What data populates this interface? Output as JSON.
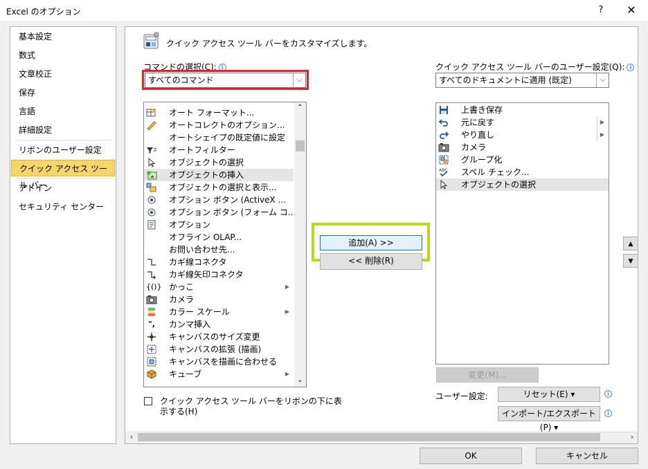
{
  "window": {
    "title": "Excel のオプション",
    "help_label": "?",
    "close_label": "✕"
  },
  "sidebar": {
    "items": [
      {
        "label": "基本設定"
      },
      {
        "label": "数式"
      },
      {
        "label": "文章校正"
      },
      {
        "label": "保存"
      },
      {
        "label": "言語"
      },
      {
        "label": "詳細設定"
      },
      {
        "label": "リボンのユーザー設定"
      },
      {
        "label": "クイック アクセス ツール バー",
        "selected": true
      },
      {
        "label": "アドイン"
      },
      {
        "label": "セキュリティ センター"
      }
    ]
  },
  "header": {
    "text": "クイック アクセス ツール バーをカスタマイズします。",
    "icon": "qat-customize-icon"
  },
  "commands": {
    "label": "コマンドの選択(C):",
    "selected": "すべてのコマンド",
    "items": [
      {
        "label": "オート フォーマット...",
        "icon": "autoformat-icon"
      },
      {
        "label": "オートコレクトのオプション...",
        "icon": "autocorrect-icon"
      },
      {
        "label": "オートシェイプの既定値に設定",
        "icon": ""
      },
      {
        "label": "オートフィルター",
        "icon": "filter-icon"
      },
      {
        "label": "オブジェクトの選択",
        "icon": "pointer-icon"
      },
      {
        "label": "オブジェクトの挿入",
        "icon": "insert-object-icon",
        "selected": true
      },
      {
        "label": "オブジェクトの選択と表示...",
        "icon": "selection-pane-icon"
      },
      {
        "label": "オプション ボタン (ActiveX ...",
        "icon": "radio-icon"
      },
      {
        "label": "オプション ボタン (フォーム コ...",
        "icon": "radio-icon"
      },
      {
        "label": "オプション",
        "icon": "options-icon"
      },
      {
        "label": "オフライン OLAP...",
        "icon": ""
      },
      {
        "label": "お問い合わせ先...",
        "icon": ""
      },
      {
        "label": "カギ線コネクタ",
        "icon": "elbow-connector-icon"
      },
      {
        "label": "カギ線矢印コネクタ",
        "icon": "elbow-arrow-icon"
      },
      {
        "label": "かっこ",
        "icon": "bracket-icon",
        "submenu": true
      },
      {
        "label": "カメラ",
        "icon": "camera-icon"
      },
      {
        "label": "カラー スケール",
        "icon": "color-scale-icon",
        "submenu": true
      },
      {
        "label": "カンマ挿入",
        "icon": "comma-icon"
      },
      {
        "label": "キャンバスのサイズ変更",
        "icon": "canvas-resize-icon"
      },
      {
        "label": "キャンバスの拡張 (描画)",
        "icon": "canvas-expand-icon"
      },
      {
        "label": "キャンバスを描画に合わせる",
        "icon": "canvas-fit-icon"
      },
      {
        "label": "キューブ",
        "icon": "cube-icon",
        "submenu": true
      }
    ]
  },
  "qat": {
    "label": "クイック アクセス ツール バーのユーザー設定(Q):",
    "selected": "すべてのドキュメントに適用 (既定)",
    "items": [
      {
        "label": "上書き保存",
        "icon": "save-icon"
      },
      {
        "label": "元に戻す",
        "icon": "undo-icon",
        "submenu": true
      },
      {
        "label": "やり直し",
        "icon": "redo-icon",
        "submenu": true
      },
      {
        "label": "カメラ",
        "icon": "camera-icon"
      },
      {
        "label": "グループ化",
        "icon": "group-icon"
      },
      {
        "label": "スペル チェック...",
        "icon": "spellcheck-icon"
      },
      {
        "label": "オブジェクトの選択",
        "icon": "pointer-icon",
        "selected": true
      }
    ]
  },
  "buttons": {
    "add": "追加(A) >>",
    "remove": "<< 削除(R)",
    "modify": "変更(M)...",
    "ok": "OK",
    "cancel": "キャンセル",
    "reset": "リセット(E) ▾",
    "import_export": "インポート/エクスポート(P) ▾"
  },
  "options": {
    "show_below_ribbon_line1": "クイック アクセス ツール バーをリボンの下に表",
    "show_below_ribbon_line2": "示する(H)",
    "user_settings_label": "ユーザー設定:"
  },
  "colors": {
    "highlight_red": "#e8202a",
    "highlight_green": "#b4dc1c",
    "nav_selected": "#f7d56a"
  }
}
